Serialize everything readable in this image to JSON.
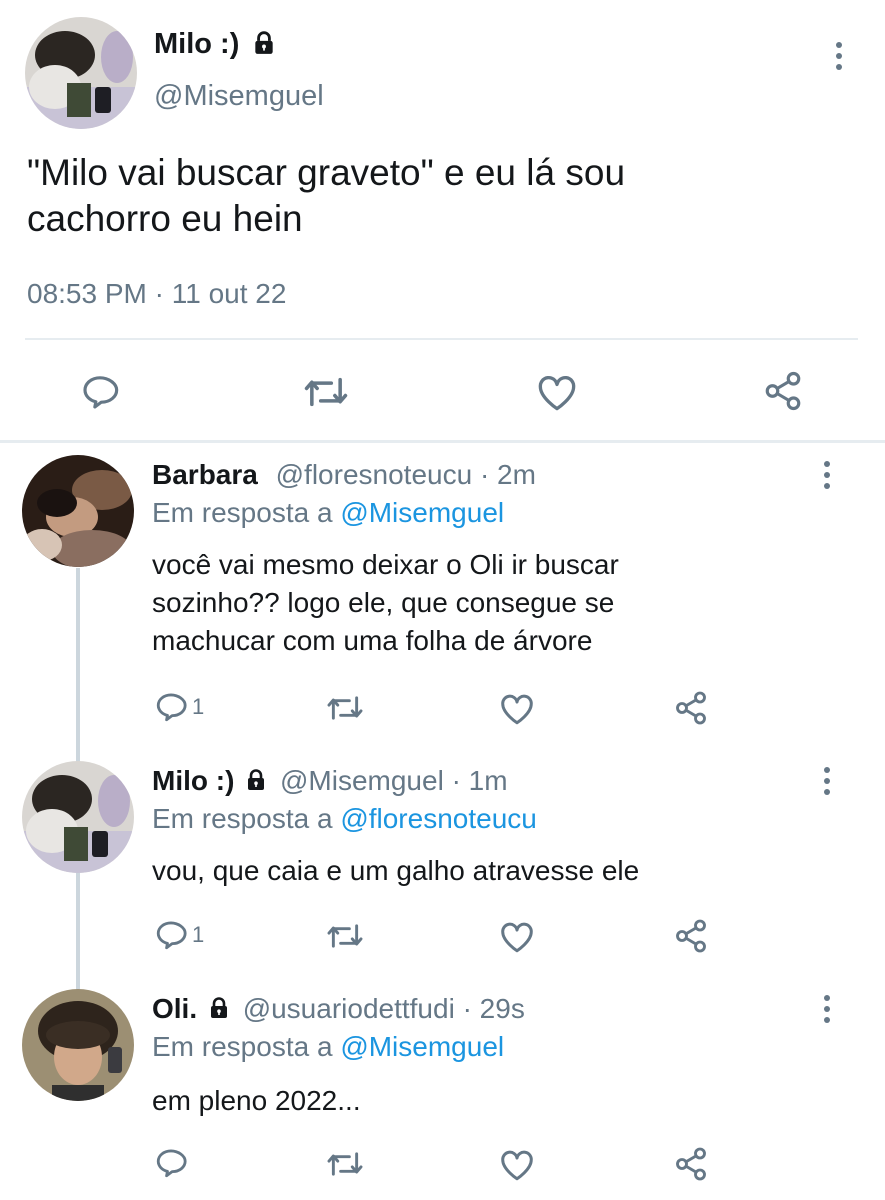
{
  "main_tweet": {
    "display_name": "Milo :)",
    "handle": "@Misemguel",
    "text_line1": "\"Milo vai buscar graveto\" e eu lá sou",
    "text_line2": "cachorro eu hein",
    "timestamp": "08:53 PM · 11 out 22"
  },
  "replies": [
    {
      "display_name": "Barbara",
      "handle": "@floresnoteucu",
      "age": "· 2m",
      "reply_prefix": "Em resposta a",
      "reply_to": "@Misemguel",
      "text_lines": [
        "você vai mesmo deixar o Oli ir buscar",
        "sozinho?? logo ele, que consegue se",
        "machucar com uma folha de árvore"
      ],
      "reply_count": "1"
    },
    {
      "display_name": "Milo :)",
      "handle": "@Misemguel",
      "age": "· 1m",
      "reply_prefix": "Em resposta a",
      "reply_to": "@floresnoteucu",
      "text_lines": [
        "vou, que caia e um galho atravesse ele"
      ],
      "reply_count": "1"
    },
    {
      "display_name": "Oli.",
      "handle": "@usuariodettfudi",
      "age": "· 29s",
      "reply_prefix": "Em resposta a",
      "reply_to": "@Misemguel",
      "text_lines": [
        "em pleno 2022..."
      ],
      "reply_count": ""
    }
  ],
  "colors": {
    "link_blue": "#1b95e0",
    "secondary_grey": "#657786",
    "text_dark": "#14171a",
    "divider": "#e6ecf0"
  },
  "icons": [
    "lock-icon",
    "more-options-icon",
    "reply-icon",
    "retweet-icon",
    "like-icon",
    "share-icon"
  ]
}
